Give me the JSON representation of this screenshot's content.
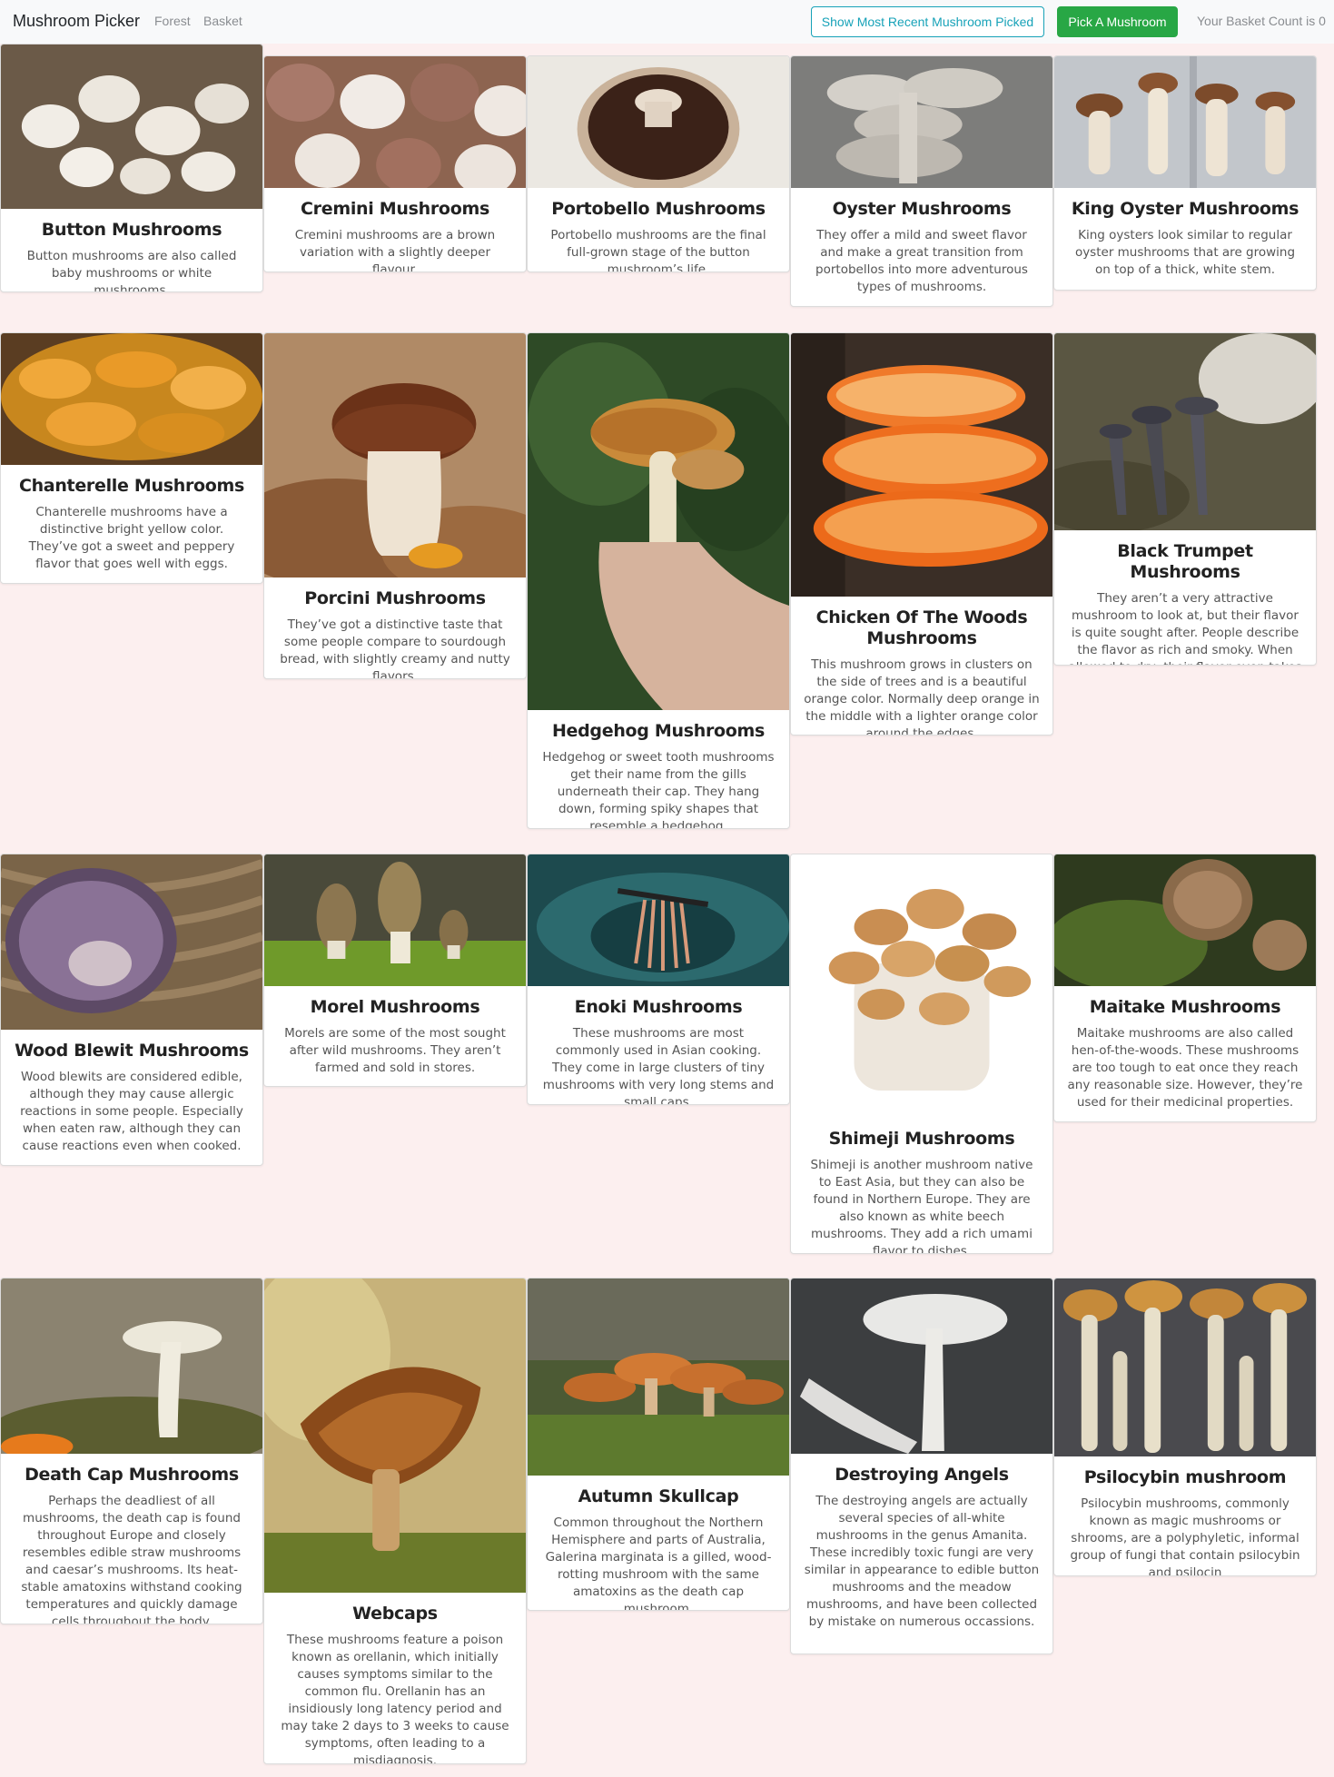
{
  "navbar": {
    "brand": "Mushroom Picker",
    "links": [
      "Forest",
      "Basket"
    ],
    "recent_button": "Show Most Recent Mushroom Picked",
    "pick_button": "Pick A Mushroom",
    "basket_count": "Your Basket Count is 0"
  },
  "mushrooms": [
    {
      "name": "Button Mushrooms",
      "desc": "Button mushrooms are also called baby mushrooms or white mushrooms."
    },
    {
      "name": "Cremini Mushrooms",
      "desc": "Cremini mushrooms are a brown variation with a slightly deeper flavour."
    },
    {
      "name": "Portobello Mushrooms",
      "desc": "Portobello mushrooms are the final full-grown stage of the button mushroom’s life."
    },
    {
      "name": "Oyster Mushrooms",
      "desc": "They offer a mild and sweet flavor and make a great transition from portobellos into more adventurous types of mushrooms."
    },
    {
      "name": "King Oyster Mushrooms",
      "desc": "King oysters look similar to regular oyster mushrooms that are growing on top of a thick, white stem."
    },
    {
      "name": "Chanterelle Mushrooms",
      "desc": "Chanterelle mushrooms have a distinctive bright yellow color. They’ve got a sweet and peppery flavor that goes well with eggs."
    },
    {
      "name": "Porcini Mushrooms",
      "desc": "They’ve got a distinctive taste that some people compare to sourdough bread, with slightly creamy and nutty flavors."
    },
    {
      "name": "Hedgehog Mushrooms",
      "desc": "Hedgehog or sweet tooth mushrooms get their name from the gills underneath their cap. They hang down, forming spiky shapes that resemble a hedgehog."
    },
    {
      "name": "Chicken Of The Woods Mushrooms",
      "desc": "This mushroom grows in clusters on the side of trees and is a beautiful orange color. Normally deep orange in the middle with a lighter orange color around the edges."
    },
    {
      "name": "Black Trumpet Mushrooms",
      "desc": "They aren’t a very attractive mushroom to look at, but their flavor is quite sought after. People describe the flavor as rich and smoky. When allowed to dry, their flavor even takes on hints of black truffle."
    },
    {
      "name": "Wood Blewit Mushrooms",
      "desc": "Wood blewits are considered edible, although they may cause allergic reactions in some people. Especially when eaten raw, although they can cause reactions even when cooked."
    },
    {
      "name": "Morel Mushrooms",
      "desc": "Morels are some of the most sought after wild mushrooms. They aren’t farmed and sold in stores."
    },
    {
      "name": "Enoki Mushrooms",
      "desc": "These mushrooms are most commonly used in Asian cooking. They come in large clusters of tiny mushrooms with very long stems and small caps."
    },
    {
      "name": "Shimeji Mushrooms",
      "desc": "Shimeji is another mushroom native to East Asia, but they can also be found in Northern Europe. They are also known as white beech mushrooms. They add a rich umami flavor to dishes."
    },
    {
      "name": "Maitake Mushrooms",
      "desc": "Maitake mushrooms are also called hen-of-the-woods. These mushrooms are too tough to eat once they reach any reasonable size. However, they’re used for their medicinal properties."
    },
    {
      "name": "Death Cap Mushrooms",
      "desc": "Perhaps the deadliest of all mushrooms, the death cap is found throughout Europe and closely resembles edible straw mushrooms and caesar’s mushrooms. Its heat-stable amatoxins withstand cooking temperatures and quickly damage cells throughout the body."
    },
    {
      "name": "Webcaps",
      "desc": "These mushrooms feature a poison known as orellanin, which initially causes symptoms similar to the common flu. Orellanin has an insidiously long latency period and may take 2 days to 3 weeks to cause symptoms, often leading to a misdiagnosis."
    },
    {
      "name": "Autumn Skullcap",
      "desc": "Common throughout the Northern Hemisphere and parts of Australia, Galerina marginata is a gilled, wood-rotting mushroom with the same amatoxins as the death cap mushroom."
    },
    {
      "name": "Destroying Angels",
      "desc": "The destroying angels are actually several species of all-white mushrooms in the genus Amanita. These incredibly toxic fungi are very similar in appearance to edible button mushrooms and the meadow mushrooms, and have been collected by mistake on numerous occassions."
    },
    {
      "name": "Psilocybin mushroom",
      "desc": "Psilocybin mushrooms, commonly known as magic mushrooms or shrooms, are a polyphyletic, informal group of fungi that contain psilocybin and psilocin"
    }
  ]
}
